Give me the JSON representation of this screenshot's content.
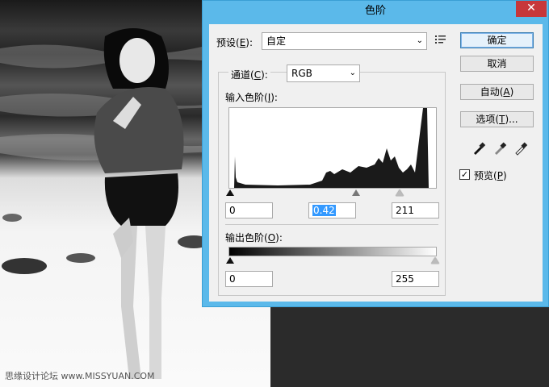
{
  "dialog": {
    "title": "色阶",
    "close_glyph": "✕",
    "preset": {
      "label_prefix": "预设(",
      "label_key": "E",
      "label_suffix": "):",
      "value": "自定"
    },
    "channel": {
      "label_prefix": "通道(",
      "label_key": "C",
      "label_suffix": "):",
      "value": "RGB"
    },
    "input_levels": {
      "label_prefix": "输入色阶(",
      "label_key": "I",
      "label_suffix": "):",
      "black": "0",
      "gamma": "0.42",
      "white": "211"
    },
    "output_levels": {
      "label_prefix": "输出色阶(",
      "label_key": "O",
      "label_suffix": "):",
      "black": "0",
      "white": "255"
    },
    "buttons": {
      "ok": "确定",
      "cancel": "取消",
      "auto_prefix": "自动(",
      "auto_key": "A",
      "auto_suffix": ")",
      "options_prefix": "选项(",
      "options_key": "T",
      "options_suffix": ")..."
    },
    "preview": {
      "label_prefix": "预览(",
      "label_key": "P",
      "label_suffix": ")",
      "checked": true
    }
  },
  "watermark": "思缘设计论坛 www.MISSYUAN.COM"
}
